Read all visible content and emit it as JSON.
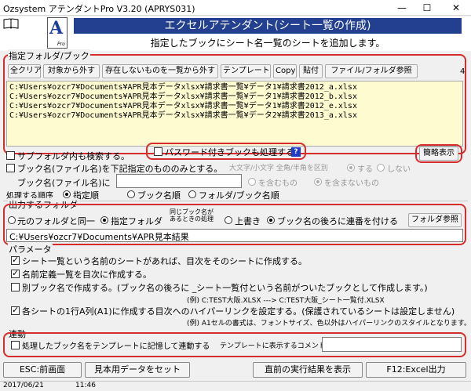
{
  "window": {
    "title": "Ozsystem アテンダントPro V3.20 (APRYS031)"
  },
  "header": {
    "logo_letter": "A",
    "logo_sub": "Pro",
    "title": "エクセルアテンダント(シート一覧の作成)",
    "description": "指定したブックにシート名一覧のシートを追加します。"
  },
  "folder_group": {
    "label": "指定フォルダ/ブック",
    "count": "4",
    "toolbar": [
      "全クリア",
      "対象から外す",
      "存在しないものを一覧から外す",
      "テンプレート",
      "Copy",
      "貼付",
      "ファイル/フォルダ参照"
    ],
    "files": [
      "C:¥Users¥ozcr7¥Documents¥APR見本データxlsx¥請求書一覧¥データ1¥請求書2012_a.xlsx",
      "C:¥Users¥ozcr7¥Documents¥APR見本データxlsx¥請求書一覧¥データ1¥請求書2012_b.xlsx",
      "C:¥Users¥ozcr7¥Documents¥APR見本データxlsx¥請求書一覧¥データ1¥請求書2012_e.xlsx",
      "C:¥Users¥ozcr7¥Documents¥APR見本データxlsx¥請求書一覧¥データ2¥請求書2013_a.xlsx"
    ],
    "subfolder_label": "サブフォルダ内も検索する。",
    "password_label": "パスワード付きブックも処理する",
    "password_help": "?",
    "simple_view": "簡略表示",
    "name_filter_label": "ブック名(ファイル名)を下記指定のもののみとする。",
    "case_label": "大文字/小文字 全角/半角を区別",
    "case_yes": "する",
    "case_no": "しない",
    "book_name_label": "ブック名(ファイル名)に",
    "book_name_value": "",
    "contains": "を含むもの",
    "not_contains": "を含まないもの",
    "order_label": "処理する順序",
    "order_options": [
      "指定順",
      "ブック名順",
      "フォルダ/ブック名順"
    ]
  },
  "output_group": {
    "label": "出力するフォルダ",
    "same_folder": "元のフォルダと同一",
    "specified_folder": "指定フォルダ",
    "same_name_handling": "同じブック名が\nあるときの処理",
    "overwrite": "上書き",
    "append_number": "ブック名の後ろに連番を付ける",
    "folder_ref": "フォルダ参照",
    "path": "C:¥Users¥ozcr7¥Documents¥APR見本結果"
  },
  "params_group": {
    "label": "パラメータ",
    "options": [
      "シート一覧という名前のシートがあれば、目次をそのシートに作成する。",
      "名前定義一覧を目次に作成する。",
      "別ブック名で作成する。(ブック名の後ろに _シート一覧付という名前がついたブックとして作成します。)",
      "各シートの1行A列(A1)に作成する目次へのハイパーリンクを設定する。(保護されているシートは設定しません)"
    ],
    "example1": "(例)  C:TEST大阪.XLSX ---> C:TEST大阪_シート一覧付.XLSX",
    "example2": "(例)  A1セルの書式は、フォントサイズ、色以外はハイパーリンクのスタイルとなります。"
  },
  "link_group": {
    "label": "連動",
    "remember_label": "処理したブック名をテンプレートに記憶して連動する",
    "comment_label": "テンプレートに表示するコメント",
    "comment_value": ""
  },
  "bottom_buttons": {
    "esc": "ESC:前画面",
    "sample": "見本用データをセット",
    "last_result": "直前の実行結果を表示",
    "run": "F12:Excel出力"
  },
  "status": {
    "date": "2017/06/21",
    "time": "11:46"
  }
}
